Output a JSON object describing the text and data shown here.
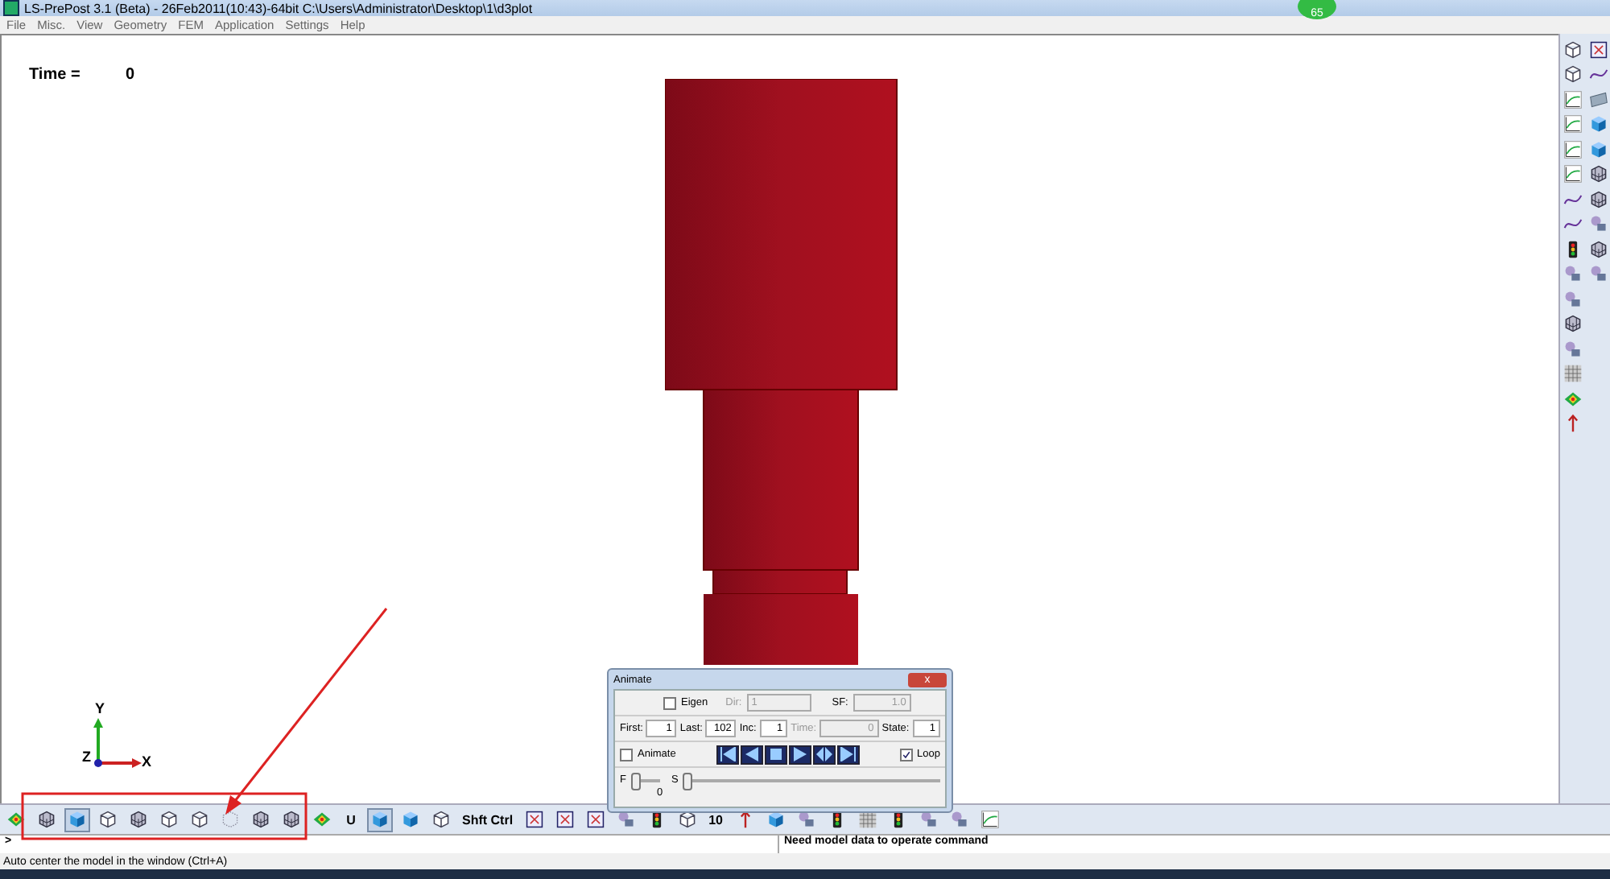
{
  "window": {
    "title": "LS-PrePost 3.1 (Beta) - 26Feb2011(10:43)-64bit C:\\Users\\Administrator\\Desktop\\1\\d3plot",
    "badge": "65"
  },
  "menu": [
    "File",
    "Misc.",
    "View",
    "Geometry",
    "FEM",
    "Application",
    "Settings",
    "Help"
  ],
  "viewport": {
    "time_label": "Time =",
    "time_value": "0",
    "axes": {
      "x": "X",
      "y": "Y",
      "z": "Z"
    }
  },
  "animate_dialog": {
    "title": "Animate",
    "close": "x",
    "eigen": {
      "label": "Eigen",
      "checked": false
    },
    "dir": {
      "label": "Dir:",
      "value": "1",
      "disabled": true
    },
    "sf": {
      "label": "SF:",
      "value": "1.0",
      "disabled": true
    },
    "fields": [
      {
        "label": "First:",
        "value": "1",
        "disabled": false
      },
      {
        "label": "Last:",
        "value": "102",
        "disabled": false
      },
      {
        "label": "Inc:",
        "value": "1",
        "disabled": false
      },
      {
        "label": "Time:",
        "value": "0",
        "disabled": true
      },
      {
        "label": "State:",
        "value": "1",
        "disabled": false
      }
    ],
    "animate": {
      "label": "Animate",
      "checked": false
    },
    "playback": [
      {
        "kind": "first"
      },
      {
        "kind": "back"
      },
      {
        "kind": "stop"
      },
      {
        "kind": "play"
      },
      {
        "kind": "bounce"
      },
      {
        "kind": "last"
      }
    ],
    "loop": {
      "label": "Loop",
      "checked": true
    },
    "f_slider": {
      "label": "F",
      "level": 0,
      "reading": "0"
    },
    "s_slider": {
      "label": "S",
      "level": 0
    }
  },
  "right_toolbar": [
    {
      "kind": "cube"
    },
    {
      "kind": "frame"
    },
    {
      "kind": "cube"
    },
    {
      "kind": "curve"
    },
    {
      "kind": "plot"
    },
    {
      "kind": "plane"
    },
    {
      "kind": "plot"
    },
    {
      "kind": "shaded"
    },
    {
      "kind": "plot"
    },
    {
      "kind": "shaded"
    },
    {
      "kind": "plot"
    },
    {
      "kind": "mesh"
    },
    {
      "kind": "curve"
    },
    {
      "kind": "mesh"
    },
    {
      "kind": "curve"
    },
    {
      "kind": "tool"
    },
    {
      "kind": "light"
    },
    {
      "kind": "mesh"
    },
    {
      "kind": "tool"
    },
    {
      "kind": "tool"
    },
    {
      "kind": "tool"
    },
    {
      "kind": "blank"
    },
    {
      "kind": "mesh"
    },
    {
      "kind": "blank"
    },
    {
      "kind": "tool"
    },
    {
      "kind": "blank"
    },
    {
      "kind": "grid"
    },
    {
      "kind": "blank"
    },
    {
      "kind": "fringe"
    },
    {
      "kind": "blank"
    },
    {
      "kind": "arrow"
    },
    {
      "kind": "blank"
    }
  ],
  "bottom_toolbar": [
    {
      "kind": "fringe",
      "selected": false
    },
    {
      "kind": "mesh",
      "selected": false
    },
    {
      "kind": "shaded",
      "selected": true
    },
    {
      "kind": "cube",
      "selected": false
    },
    {
      "kind": "mesh",
      "selected": false
    },
    {
      "kind": "cube",
      "selected": false
    },
    {
      "kind": "cube",
      "selected": false
    },
    {
      "kind": "dots",
      "selected": false
    },
    {
      "kind": "mesh",
      "selected": false
    },
    {
      "kind": "mesh",
      "selected": false
    },
    {
      "kind": "fringe",
      "selected": false
    },
    {
      "kind": "text",
      "label": "U",
      "selected": false
    },
    {
      "kind": "shaded",
      "selected": true
    },
    {
      "kind": "shaded",
      "selected": false
    },
    {
      "kind": "cube",
      "selected": false
    },
    {
      "kind": "text",
      "label": "Shft Ctrl",
      "selected": false
    },
    {
      "kind": "frame",
      "selected": false
    },
    {
      "kind": "frame",
      "selected": false
    },
    {
      "kind": "frame",
      "selected": false
    },
    {
      "kind": "tool",
      "selected": false
    },
    {
      "kind": "light",
      "selected": false
    },
    {
      "kind": "cube",
      "selected": false
    },
    {
      "kind": "text",
      "label": "10",
      "selected": false
    },
    {
      "kind": "arrow",
      "selected": false
    },
    {
      "kind": "shaded",
      "selected": false
    },
    {
      "kind": "tool",
      "selected": false
    },
    {
      "kind": "light",
      "selected": false
    },
    {
      "kind": "grid",
      "selected": false
    },
    {
      "kind": "light",
      "selected": false
    },
    {
      "kind": "tool",
      "selected": false
    },
    {
      "kind": "tool",
      "selected": false
    },
    {
      "kind": "plot",
      "selected": false
    }
  ],
  "command_line": {
    "prompt": ">",
    "message": "Need model data to operate command"
  },
  "status_bar": "Auto center the model in the window (Ctrl+A)"
}
